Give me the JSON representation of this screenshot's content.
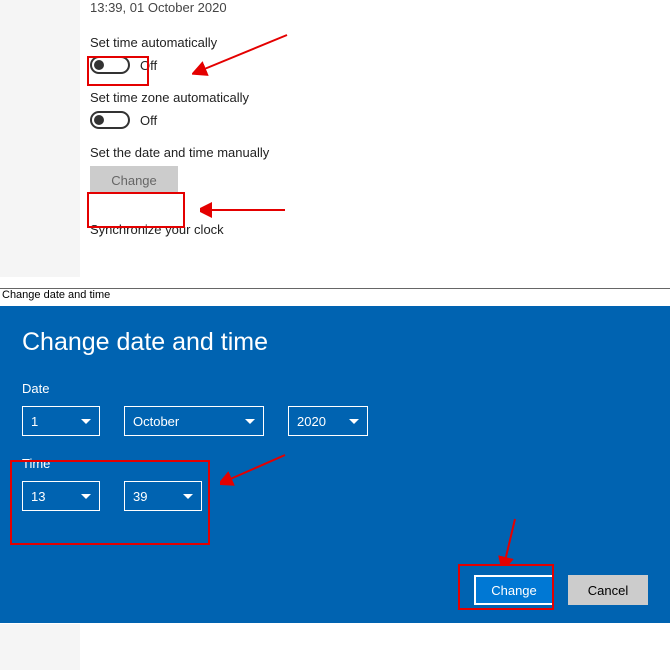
{
  "currentTime": "13:39, 01 October 2020",
  "setTimeAuto": {
    "label": "Set time automatically",
    "state": "Off"
  },
  "setTzAuto": {
    "label": "Set time zone automatically",
    "state": "Off"
  },
  "manual": {
    "label": "Set the date and time manually",
    "button": "Change"
  },
  "sync": {
    "label": "Synchronize your clock"
  },
  "dialog": {
    "titlebar": "Change date and time",
    "heading": "Change date and time",
    "dateLabel": "Date",
    "timeLabel": "Time",
    "day": "1",
    "month": "October",
    "year": "2020",
    "hour": "13",
    "minute": "39",
    "change": "Change",
    "cancel": "Cancel"
  }
}
